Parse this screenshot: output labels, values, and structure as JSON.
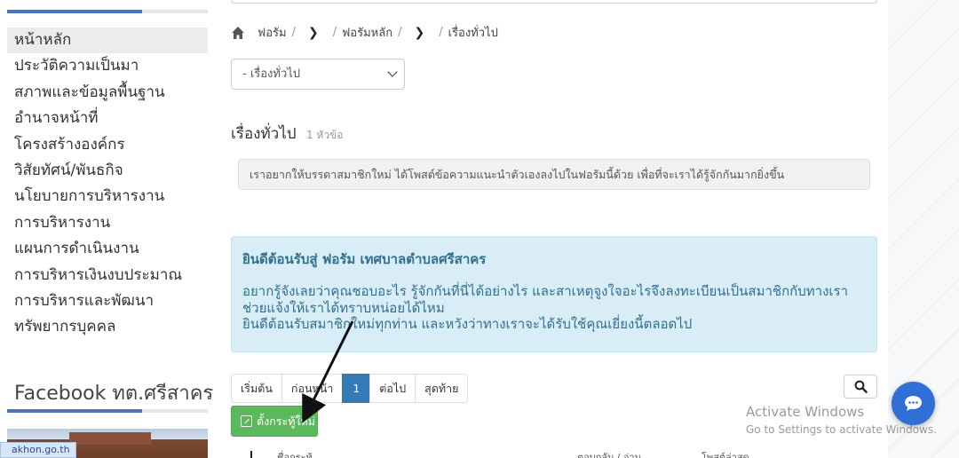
{
  "sidebar": {
    "menu": [
      "หน้าหลัก",
      "ประวัติความเป็นมา",
      "สภาพและข้อมูลพื้นฐาน",
      "อำนาจหน้าที่",
      "โครงสร้างองค์กร",
      "วิสัยทัศน์/พันธกิจ",
      "นโยบายการบริหารงาน",
      "การบริหารงาน",
      "แผนการดำเนินงาน",
      "การบริหารเงินงบประมาณ",
      "การบริหารและพัฒนาทรัพยากรบุคคล"
    ],
    "facebook_title": "Facebook ทต.ศรีสาคร",
    "url_chip": "akhon.go.th"
  },
  "breadcrumb": {
    "home_icon": "home-icon",
    "item1": "ฟอรัม",
    "item2": "ฟอรัมหลัก",
    "item3": "เรื่องทั่วไป",
    "separator": "/"
  },
  "category_select": {
    "value": "- เรื่องทั่วไป"
  },
  "forum": {
    "title": "เรื่องทั่วไป",
    "count": "1 หัวข้อ",
    "description": "เราอยากให้บรรดาสมาชิกใหม่ ได้โพสต์ข้อความแนะนำตัวเองลงไปในฟอรัมนี้ด้วย เพื่อที่จะเราได้รู้จักกันมากยิ่งขึ้น"
  },
  "welcome": {
    "title": "ยินดีต้อนรับสู่ ฟอรัม เทศบาลตำบลศรีสาคร",
    "line1": "อยากรู้จังเลยว่าคุณชอบอะไร รู้จักกันที่นี่ได้อย่างไร และสาเหตุจูงใจอะไรจึงลงทะเบียนเป็นสมาชิกกับทางเรา ช่วยแจ้งให้เราได้ทราบหน่อยได้ไหม",
    "line2": "ยินดีต้อนรับสมาชิกใหม่ทุกท่าน และหวังว่าทางเราจะได้รับใช้คุณเยี่ยงนี้ตลอดไป"
  },
  "pagination": {
    "first": "เริ่มต้น",
    "prev": "ก่อนหน้า",
    "current": "1",
    "next": "ต่อไป",
    "last": "สุดท้าย"
  },
  "buttons": {
    "new_topic": "ตั้งกระทู้ใหม่",
    "search_icon": "search-icon"
  },
  "table": {
    "col_topic": "ชื่อกระทู้",
    "col_replies": "ตอบกลับ / อ่าน",
    "col_last_post": "โพสต์ล่าสุด"
  },
  "windows": {
    "activate_title": "Activate Windows",
    "activate_sub": "Go to Settings to activate Windows."
  },
  "colors": {
    "accent_blue": "#4a72c2",
    "pager_active": "#337ab7",
    "new_topic_green": "#5cb85c",
    "welcome_bg": "#d9edf7",
    "welcome_text": "#31708f",
    "chat_blue": "#2f6fd6"
  }
}
